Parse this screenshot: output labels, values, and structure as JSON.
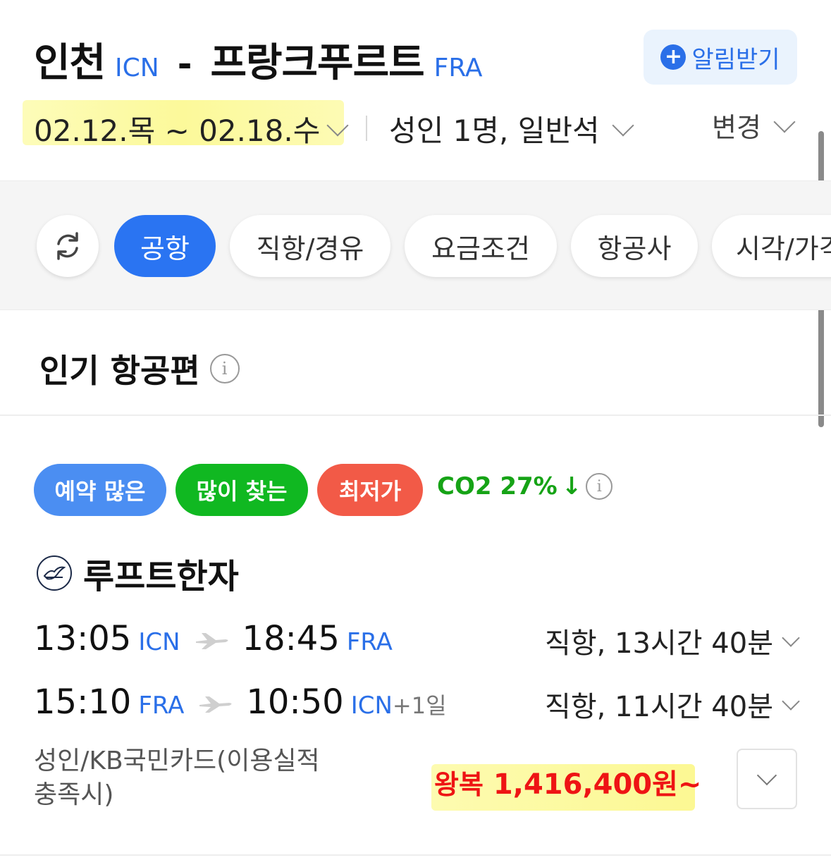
{
  "header": {
    "origin_city": "인천",
    "origin_code": "ICN",
    "separator": "-",
    "dest_city": "프랑크푸르트",
    "dest_code": "FRA",
    "alert_label": "알림받기",
    "dates": "02.12.목 ~ 02.18.수",
    "passengers": "성인 1명, 일반석",
    "change_label": "변경"
  },
  "filters": {
    "chips": [
      "공항",
      "직항/경유",
      "요금조건",
      "항공사",
      "시각/가격"
    ],
    "active_index": 0
  },
  "section": {
    "title": "인기 항공편"
  },
  "badges": [
    {
      "label": "예약 많은",
      "color": "#4b8ef2"
    },
    {
      "label": "많이 찾는",
      "color": "#10b821"
    },
    {
      "label": "최저가",
      "color": "#f25a47"
    }
  ],
  "co2": {
    "label": "CO2 27%",
    "arrow": "↓",
    "color": "#16a316"
  },
  "flight": {
    "airline": "루프트한자",
    "legs": [
      {
        "dep_time": "13:05",
        "dep_code": "ICN",
        "arr_time": "18:45",
        "arr_code": "FRA",
        "day_offset": "",
        "info": "직항, 13시간 40분"
      },
      {
        "dep_time": "15:10",
        "dep_code": "FRA",
        "arr_time": "10:50",
        "arr_code": "ICN",
        "day_offset": "+1일",
        "info": "직항, 11시간 40분"
      }
    ],
    "fare_note": "성인/KB국민카드(이용실적 충족시)",
    "price_prefix": "왕복",
    "price": "1,416,400원~",
    "price_color": "#ee1414"
  },
  "colors": {
    "accent": "#2a6fe8",
    "active_chip": "#2a74f2",
    "highlight": "#fcf99a"
  }
}
